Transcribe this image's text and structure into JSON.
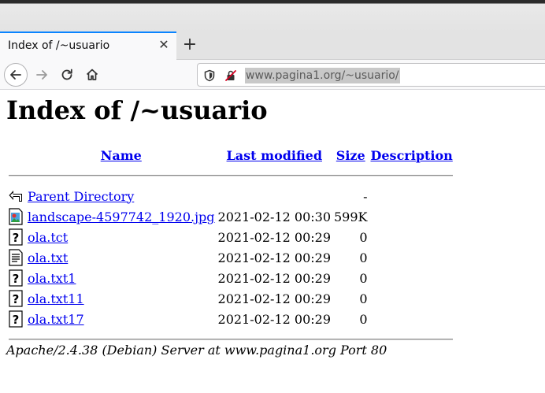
{
  "browser": {
    "tab_title": "Index of /~usuario",
    "tab_close": "✕",
    "new_tab": "+",
    "url": "www.pagina1.org/~usuario/"
  },
  "page": {
    "heading": "Index of /~usuario",
    "columns": {
      "name": "Name",
      "modified": "Last modified",
      "size": "Size",
      "description": "Description"
    },
    "parent": {
      "name": "Parent Directory",
      "size": "-"
    },
    "rows": [
      {
        "icon": "image-file-icon",
        "name": "landscape-4597742_1920.jpg",
        "modified": "2021-02-12 00:30",
        "size": "599K"
      },
      {
        "icon": "unknown-file-icon",
        "name": "ola.tct",
        "modified": "2021-02-12 00:29",
        "size": "0"
      },
      {
        "icon": "text-file-icon",
        "name": "ola.txt",
        "modified": "2021-02-12 00:29",
        "size": "0"
      },
      {
        "icon": "unknown-file-icon",
        "name": "ola.txt1",
        "modified": "2021-02-12 00:29",
        "size": "0"
      },
      {
        "icon": "unknown-file-icon",
        "name": "ola.txt11",
        "modified": "2021-02-12 00:29",
        "size": "0"
      },
      {
        "icon": "unknown-file-icon",
        "name": "ola.txt17",
        "modified": "2021-02-12 00:29",
        "size": "0"
      }
    ],
    "footer": "Apache/2.4.38 (Debian) Server at www.pagina1.org Port 80"
  }
}
